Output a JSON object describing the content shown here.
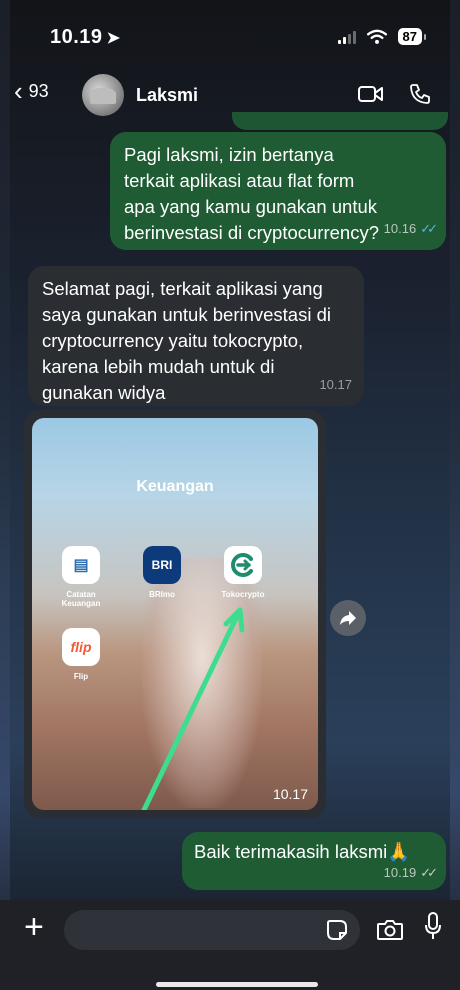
{
  "status": {
    "time": "10.19",
    "battery": "87"
  },
  "header": {
    "back_count": "93",
    "contact_name": "Laksmi"
  },
  "messages": [
    {
      "dir": "out",
      "text": "Pagi laksmi, izin bertanya terkait aplikasi atau flat form apa yang kamu gunakan untuk berinvestasi di cryptocurrency?",
      "time": "10.16",
      "status": "read"
    },
    {
      "dir": "in",
      "text": "Selamat pagi, terkait aplikasi yang saya gunakan untuk berinvestasi di cryptocurrency yaitu tokocrypto, karena lebih mudah untuk di gunakan widya",
      "time": "10.17"
    },
    {
      "dir": "in",
      "type": "image",
      "time": "10.17",
      "image": {
        "folder_title": "Keuangan",
        "apps": [
          "Catatan Keuangan",
          "BRImo",
          "Tokocrypto",
          "Flip"
        ]
      }
    },
    {
      "dir": "out",
      "text": "Baik terimakasih laksmi🙏",
      "time": "10.19",
      "status": "delivered"
    }
  ],
  "colors": {
    "outgoing": "#1f5c34",
    "incoming": "#2a2d31",
    "read_check": "#4fb6ec",
    "arrow": "#3ddc8f"
  },
  "icons": [
    "location-arrow-icon",
    "signal-icon",
    "wifi-icon",
    "battery-icon",
    "back-chevron-icon",
    "video-call-icon",
    "phone-call-icon",
    "forward-icon",
    "plus-icon",
    "sticker-icon",
    "camera-icon",
    "mic-icon"
  ]
}
